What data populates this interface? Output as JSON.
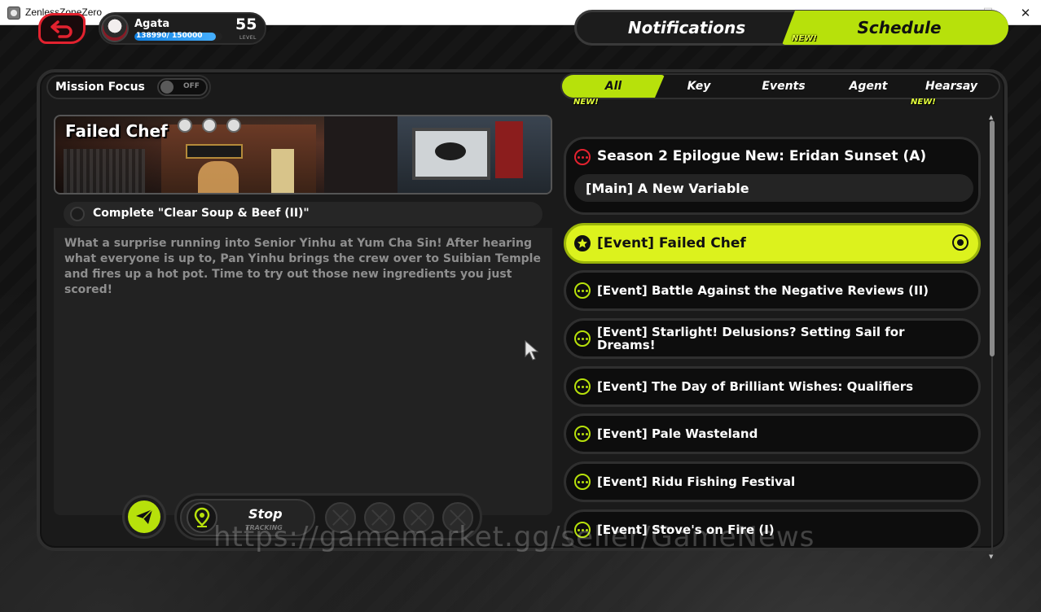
{
  "window": {
    "title": "ZenlessZoneZero",
    "minimize_glyph": "—",
    "maximize_glyph": "☐",
    "close_glyph": "✕"
  },
  "player": {
    "name": "Agata",
    "xp_text": "138990/ 150000",
    "xp_fraction": 0.9266,
    "level": "55",
    "level_label": "LEVEL"
  },
  "top_tabs": {
    "notifications_label": "Notifications",
    "schedule_label": "Schedule",
    "schedule_badge": "NEW!",
    "active": "Schedule"
  },
  "mission_focus": {
    "label": "Mission Focus",
    "toggle_text": "OFF"
  },
  "filter_tabs": [
    {
      "label": "All",
      "badge": "NEW!",
      "active": true
    },
    {
      "label": "Key",
      "badge": "",
      "active": false
    },
    {
      "label": "Events",
      "badge": "",
      "active": false
    },
    {
      "label": "Agent",
      "badge": "",
      "active": false
    },
    {
      "label": "Hearsay",
      "badge": "NEW!",
      "active": false
    }
  ],
  "detail": {
    "title": "Failed Chef",
    "banner_sign": "",
    "objective": "Complete \"Clear Soup & Beef (II)\"",
    "description": "What a surprise running into Senior Yinhu at Yum Cha Sin! After hearing what everyone is up to, Pan Yinhu brings the crew over to Suibian Temple and fires up a hot pot. Time to try out those new ingredients you just scored!"
  },
  "tracking": {
    "stop_label": "Stop",
    "tracking_label": "TRACKING"
  },
  "missions": {
    "main": {
      "title": "Season 2 Epilogue New: Eridan Sunset (A)",
      "subtitle": "[Main] A New Variable"
    },
    "list": [
      {
        "label": "[Event] Failed Chef",
        "active": true
      },
      {
        "label": "[Event] Battle Against the Negative Reviews (II)",
        "active": false
      },
      {
        "label": "[Event] Starlight! Delusions? Setting Sail for Dreams!",
        "active": false
      },
      {
        "label": "[Event] The Day of Brilliant Wishes: Qualifiers",
        "active": false
      },
      {
        "label": "[Event] Pale Wasteland",
        "active": false
      },
      {
        "label": "[Event] Ridu Fishing Festival",
        "active": false
      },
      {
        "label": "[Event] Stove's on Fire (I)",
        "active": false
      }
    ]
  },
  "watermark": "https://gamemarket.gg/seller/GameNews",
  "colors": {
    "accent": "#b7e10b",
    "accent_active_card": "#dcf21d",
    "back_red": "#e3222f",
    "xp_blue": "#1e90ff",
    "description_gray": "#8e8e8e"
  }
}
